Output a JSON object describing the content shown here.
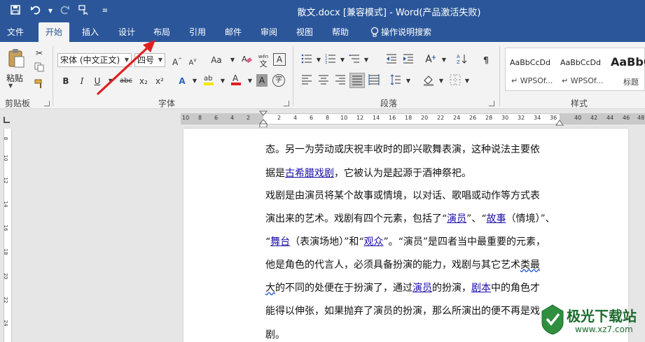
{
  "window": {
    "title": "散文.docx [兼容模式]  -  Word(产品激活失败)",
    "qat_icons": [
      "save-icon",
      "undo-icon",
      "redo-icon",
      "touch-mode-icon",
      "customize-icon"
    ]
  },
  "tabs": [
    {
      "label": "文件",
      "active": false
    },
    {
      "label": "开始",
      "active": true
    },
    {
      "label": "插入",
      "active": false
    },
    {
      "label": "设计",
      "active": false
    },
    {
      "label": "布局",
      "active": false
    },
    {
      "label": "引用",
      "active": false
    },
    {
      "label": "邮件",
      "active": false
    },
    {
      "label": "审阅",
      "active": false
    },
    {
      "label": "视图",
      "active": false
    },
    {
      "label": "帮助",
      "active": false
    }
  ],
  "tell_me": "操作说明搜索",
  "ribbon": {
    "clipboard": {
      "paste_label": "粘贴",
      "group_label": "剪贴板"
    },
    "font": {
      "font_name": "宋体 (中文正文)",
      "font_size": "四号",
      "group_label": "字体",
      "wen_label": "wén",
      "wen_char": "文",
      "A_label": "A",
      "Aa_label": "Aa",
      "zi_char": "字",
      "bold": "B",
      "italic": "I",
      "underline": "U",
      "strike": "abc",
      "sub": "x₂",
      "sup": "x²"
    },
    "paragraph": {
      "group_label": "段落"
    },
    "styles": {
      "group_label": "样式",
      "items": [
        {
          "preview": "AaBbCcDd",
          "name": "↵ WPSOf..."
        },
        {
          "preview": "AaBbCcDd",
          "name": "↵ WPSOf..."
        },
        {
          "preview": "AaBbC",
          "name": "标题"
        }
      ]
    }
  },
  "ruler": {
    "numbers": [
      "10",
      "8",
      "6",
      "4",
      "2",
      "2",
      "4",
      "6",
      "8",
      "10",
      "12",
      "14",
      "16",
      "18",
      "20",
      "22",
      "24",
      "26",
      "28",
      "30",
      "32",
      "34",
      "36",
      "40",
      "42",
      "44",
      "46",
      "48"
    ],
    "vertical": [
      "8",
      "10",
      "12",
      "14",
      "16",
      "18",
      "20",
      "22",
      "24"
    ]
  },
  "document": {
    "lines": [
      [
        {
          "t": "态。另一为劳动或庆祝丰收时的即兴歌舞表演，这种说法主要依"
        }
      ],
      [
        {
          "t": "据是"
        },
        {
          "t": "古希腊戏剧",
          "link": true
        },
        {
          "t": "，它被认为是起源于酒神祭祀。"
        }
      ],
      [
        {
          "t": "戏剧是由演员将某个故事或情境，以对话、歌唱或动作等方式表"
        }
      ],
      [
        {
          "t": "演出来的艺术。戏剧有四个元素，包括了“"
        },
        {
          "t": "演员",
          "link": true
        },
        {
          "t": "”、“"
        },
        {
          "t": "故事",
          "link": true
        },
        {
          "t": "（情境）”、"
        }
      ],
      [
        {
          "t": "“"
        },
        {
          "t": "舞台",
          "link": true
        },
        {
          "t": "（表演场地）”和“"
        },
        {
          "t": "观众",
          "link": true
        },
        {
          "t": "”。“演员”是四者当中最重要的元素，"
        }
      ],
      [
        {
          "t": "他是角色的代言人，必须具备扮演的能力，戏剧与其它艺术"
        },
        {
          "t": "类最",
          "wavy": true
        }
      ],
      [
        {
          "t": "大",
          "wavy": true
        },
        {
          "t": "的不同的处便在于扮演了，通过"
        },
        {
          "t": "演员",
          "link": true
        },
        {
          "t": "的扮演，"
        },
        {
          "t": "剧本",
          "link": true
        },
        {
          "t": "中的角色才"
        }
      ],
      [
        {
          "t": "能得以伸张，如果抛弃了演员的扮演，那么所演出的便不再是戏"
        }
      ],
      [
        {
          "t": "剧。"
        }
      ]
    ]
  },
  "watermark": {
    "name": "极光下载站",
    "url": "www.xz7.com"
  },
  "colors": {
    "brand": "#2b579a",
    "link": "#1a0dab",
    "arrow": "#e02020",
    "watermark": "#1d6a2e"
  }
}
